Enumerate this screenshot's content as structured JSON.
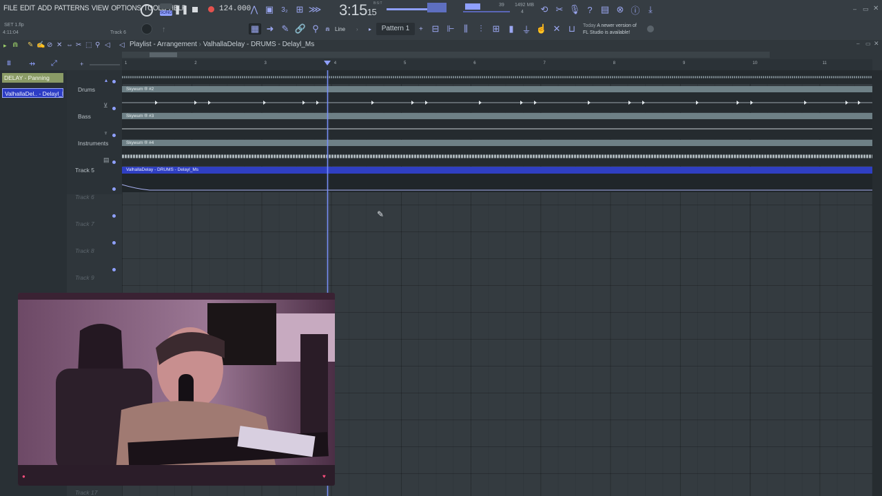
{
  "menu": [
    "FILE",
    "EDIT",
    "ADD",
    "PATTERNS",
    "VIEW",
    "OPTIONS",
    "TOOLS",
    "HELP"
  ],
  "transport": {
    "mode_label": "SONG",
    "tempo": "124.000",
    "time_main": "3:15",
    "time_sub": "15",
    "time_sup": "B:S:T",
    "cpu": "39",
    "mem": "1492 MB",
    "poly": "4"
  },
  "hint": {
    "file": "SET 1.flp",
    "time": "4:11:04",
    "track": "Track 6"
  },
  "toolbar2": {
    "snap": "Line",
    "pattern": "Pattern 1"
  },
  "news": {
    "day": "Today",
    "line1": "A newer version of",
    "line2": "FL Studio is available!"
  },
  "breadcrumb": {
    "root": "Playlist - Arrangement",
    "sep": "›",
    "item": "ValhallaDelay - DRUMS - Delayl_Ms"
  },
  "ruler": [
    "1",
    "2",
    "3",
    "4",
    "5",
    "6",
    "7",
    "8",
    "9",
    "10",
    "11"
  ],
  "patterns": [
    {
      "label": "DELAY - Panning",
      "selected": false
    },
    {
      "label": "ValhallaDel.. - Delayl_Ms",
      "selected": true
    }
  ],
  "tracks": [
    {
      "name": "Drums",
      "active": true
    },
    {
      "name": "Bass",
      "active": true
    },
    {
      "name": "Instruments",
      "active": true
    },
    {
      "name": "Track 5",
      "active": true
    },
    {
      "name": "Track 6",
      "active": false
    },
    {
      "name": "Track 7",
      "active": false
    },
    {
      "name": "Track 8",
      "active": false
    },
    {
      "name": "Track 9",
      "active": false
    },
    {
      "name": "Track 17",
      "active": false
    }
  ],
  "clips": [
    {
      "label": "Skywum ® #2"
    },
    {
      "label": "Skywum ® #3"
    },
    {
      "label": "Skywum ® #4"
    },
    {
      "label": "ValhallaDelay - DRUMS - Delayl_Ms"
    }
  ],
  "colors": {
    "accent": "#8fa0ff",
    "automation_clip": "#2f3fc2",
    "audio_clip_header": "#6e8086"
  }
}
